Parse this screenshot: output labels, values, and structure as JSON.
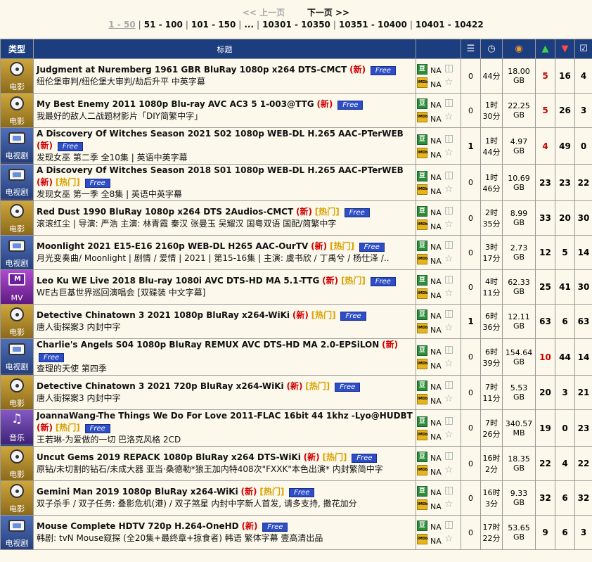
{
  "pager": {
    "prev": "<< 上一页",
    "next": "下一页 >>",
    "ranges": [
      "1 - 50",
      "51 - 100",
      "101 - 150",
      "...",
      "10301 - 10350",
      "10351 - 10400",
      "10401 - 10422"
    ]
  },
  "header": {
    "type": "类型",
    "title": "标题"
  },
  "rating_labels": {
    "na": "NA",
    "douban_badge": "豆",
    "imdb_badge": "IMDb"
  },
  "tags": {
    "new": "(新)",
    "hot": "[热门]",
    "free": "Free"
  },
  "torrents": [
    {
      "category": "电影",
      "cat": "movie",
      "title": "Judgment at Nuremberg 1961 GBR BluRay 1080p x264 DTS-CMCT",
      "hot": false,
      "subtitle": "纽伦堡审判/纽伦堡大审判/劫后升平 中英字幕",
      "comments": "0",
      "time1": "44分",
      "time2": "",
      "size1": "18.00",
      "size2": "GB",
      "seeders": "5",
      "seeders_red": true,
      "leechers": "16",
      "completed": "4"
    },
    {
      "category": "电影",
      "cat": "movie",
      "title": "My Best Enemy 2011 1080p Blu-ray AVC AC3 5 1-003@TTG",
      "hot": false,
      "subtitle": "我最好的敌人二战题材影片「DIY简繁中字」",
      "comments": "0",
      "time1": "1时",
      "time2": "30分",
      "size1": "22.25",
      "size2": "GB",
      "seeders": "5",
      "seeders_red": true,
      "leechers": "26",
      "completed": "3"
    },
    {
      "category": "电视剧",
      "cat": "tv",
      "title": "A Discovery Of Witches Season 2021 S02 1080p WEB-DL H.265 AAC-PTerWEB",
      "hot": false,
      "subtitle": "发现女巫 第二季 全10集 | 英语中英字幕",
      "comments": "1",
      "time1": "1时",
      "time2": "44分",
      "size1": "4.97",
      "size2": "GB",
      "seeders": "4",
      "seeders_red": true,
      "leechers": "49",
      "completed": "0"
    },
    {
      "category": "电视剧",
      "cat": "tv",
      "title": "A Discovery Of Witches Season 2018 S01 1080p WEB-DL H.265 AAC-PTerWEB",
      "hot": true,
      "subtitle": "发现女巫 第一季 全8集 | 英语中英字幕",
      "comments": "0",
      "time1": "1时",
      "time2": "46分",
      "size1": "10.69",
      "size2": "GB",
      "seeders": "23",
      "seeders_red": false,
      "leechers": "23",
      "completed": "22"
    },
    {
      "category": "电影",
      "cat": "movie",
      "title": "Red Dust 1990 BluRay 1080p x264 DTS 2Audios-CMCT",
      "hot": true,
      "subtitle": "滚滚红尘 | 导演: 严浩 主演: 林青霞 秦汉 张曼玉 吴耀汉 国粤双语 国配/简繁中字",
      "comments": "0",
      "time1": "2时",
      "time2": "35分",
      "size1": "8.99",
      "size2": "GB",
      "seeders": "33",
      "seeders_red": false,
      "leechers": "20",
      "completed": "30"
    },
    {
      "category": "电视剧",
      "cat": "tv",
      "title": "Moonlight 2021 E15-E16 2160p WEB-DL H265 AAC-OurTV",
      "hot": true,
      "subtitle": "月光变奏曲/ Moonlight | 剧情 / 爱情 | 2021 | 第15-16集 | 主演: 虞书欣 / 丁禹兮 / 杨仕泽 /..",
      "comments": "0",
      "time1": "3时",
      "time2": "17分",
      "size1": "2.73",
      "size2": "GB",
      "seeders": "12",
      "seeders_red": false,
      "leechers": "5",
      "completed": "14"
    },
    {
      "category": "MV",
      "cat": "mv",
      "title": "Leo Ku WE Live 2018 Blu-ray 1080i AVC DTS-HD MA 5.1-TTG",
      "hot": true,
      "subtitle": "WE古巨基世界巡回演唱会 [双碟装 中文字幕]",
      "comments": "0",
      "time1": "4时",
      "time2": "11分",
      "size1": "62.33",
      "size2": "GB",
      "seeders": "25",
      "seeders_red": false,
      "leechers": "41",
      "completed": "30"
    },
    {
      "category": "电影",
      "cat": "movie",
      "title": "Detective Chinatown 3 2021 1080p BluRay x264-WiKi",
      "hot": true,
      "subtitle": "唐人街探案3 内封中字",
      "comments": "1",
      "time1": "6时",
      "time2": "36分",
      "size1": "12.11",
      "size2": "GB",
      "seeders": "63",
      "seeders_red": false,
      "leechers": "6",
      "completed": "63"
    },
    {
      "category": "电视剧",
      "cat": "tv",
      "title": "Charlie's Angels S04 1080p BluRay REMUX AVC DTS-HD MA 2.0-EPSiLON",
      "hot": false,
      "subtitle": "查理的天使 第四季",
      "comments": "0",
      "time1": "6时",
      "time2": "39分",
      "size1": "154.64",
      "size2": "GB",
      "seeders": "10",
      "seeders_red": true,
      "leechers": "44",
      "completed": "14"
    },
    {
      "category": "电影",
      "cat": "movie",
      "title": "Detective Chinatown 3 2021 720p BluRay x264-WiKi",
      "hot": true,
      "subtitle": "唐人街探案3 内封中字",
      "comments": "0",
      "time1": "7时",
      "time2": "11分",
      "size1": "5.53",
      "size2": "GB",
      "seeders": "20",
      "seeders_red": false,
      "leechers": "3",
      "completed": "21"
    },
    {
      "category": "音乐",
      "cat": "music",
      "title": "JoannaWang-The Things We Do For Love 2011-FLAC 16bit 44 1khz -Lyo@HUDBT",
      "hot": true,
      "subtitle": "王若琳-为爱做的一切 巴洛克风格 2CD",
      "comments": "0",
      "time1": "7时",
      "time2": "26分",
      "size1": "340.57",
      "size2": "MB",
      "seeders": "19",
      "seeders_red": false,
      "leechers": "0",
      "completed": "23"
    },
    {
      "category": "电影",
      "cat": "movie",
      "title": "Uncut Gems 2019 REPACK 1080p BluRay x264 DTS-WiKi",
      "hot": true,
      "subtitle": "原钻/未切割的钻石/未成大器 亚当·桑德勒*狼王加内特408次\"FXXK\"本色出演* 内封繁简中字",
      "comments": "0",
      "time1": "16时",
      "time2": "2分",
      "size1": "18.35",
      "size2": "GB",
      "seeders": "22",
      "seeders_red": false,
      "leechers": "4",
      "completed": "22"
    },
    {
      "category": "电影",
      "cat": "movie",
      "title": "Gemini Man 2019 1080p BluRay x264-WiKi",
      "hot": true,
      "subtitle": "双子杀手 / 双子任务: 叠影危机(港) / 双子煞星 内封中字新人首发, 请多支持, 撒花加分",
      "comments": "0",
      "time1": "16时",
      "time2": "3分",
      "size1": "9.33",
      "size2": "GB",
      "seeders": "32",
      "seeders_red": false,
      "leechers": "6",
      "completed": "32"
    },
    {
      "category": "电视剧",
      "cat": "tv",
      "title": "Mouse Complete HDTV 720p H.264-OneHD",
      "hot": false,
      "subtitle": "韩剧: tvN Mouse窥探 (全20集+最终章+掠食者) 韩语 繁体字幕 壹高清出品",
      "comments": "0",
      "time1": "17时",
      "time2": "22分",
      "size1": "53.65",
      "size2": "GB",
      "seeders": "9",
      "seeders_red": false,
      "leechers": "6",
      "completed": "3"
    }
  ]
}
